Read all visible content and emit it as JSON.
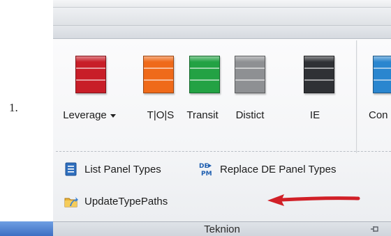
{
  "step_number": "1.",
  "ribbon": {
    "panel_types": [
      {
        "label": "Leverage",
        "color": "#c81e28",
        "has_dropdown": true
      },
      {
        "label": "T|O|S",
        "color": "#ef6a1a",
        "has_dropdown": false
      },
      {
        "label": "Transit",
        "color": "#23a244",
        "has_dropdown": false
      },
      {
        "label": "Distict",
        "color": "#8e9093",
        "has_dropdown": false
      },
      {
        "label": "IE",
        "color": "#2f3135",
        "has_dropdown": false
      },
      {
        "label": "Con",
        "color": "#2a86cf",
        "has_dropdown": false
      }
    ],
    "commands": {
      "list_panel_types": "List Panel Types",
      "replace_de_panel_types": "Replace DE Panel Types",
      "update_type_paths": "UpdateTypePaths"
    },
    "replace_icon_text": {
      "top": "DE",
      "bottom": "PM"
    },
    "panel_title": "Teknion"
  },
  "annotation": {
    "arrow_color": "#d12027",
    "target": "update_type_paths"
  }
}
